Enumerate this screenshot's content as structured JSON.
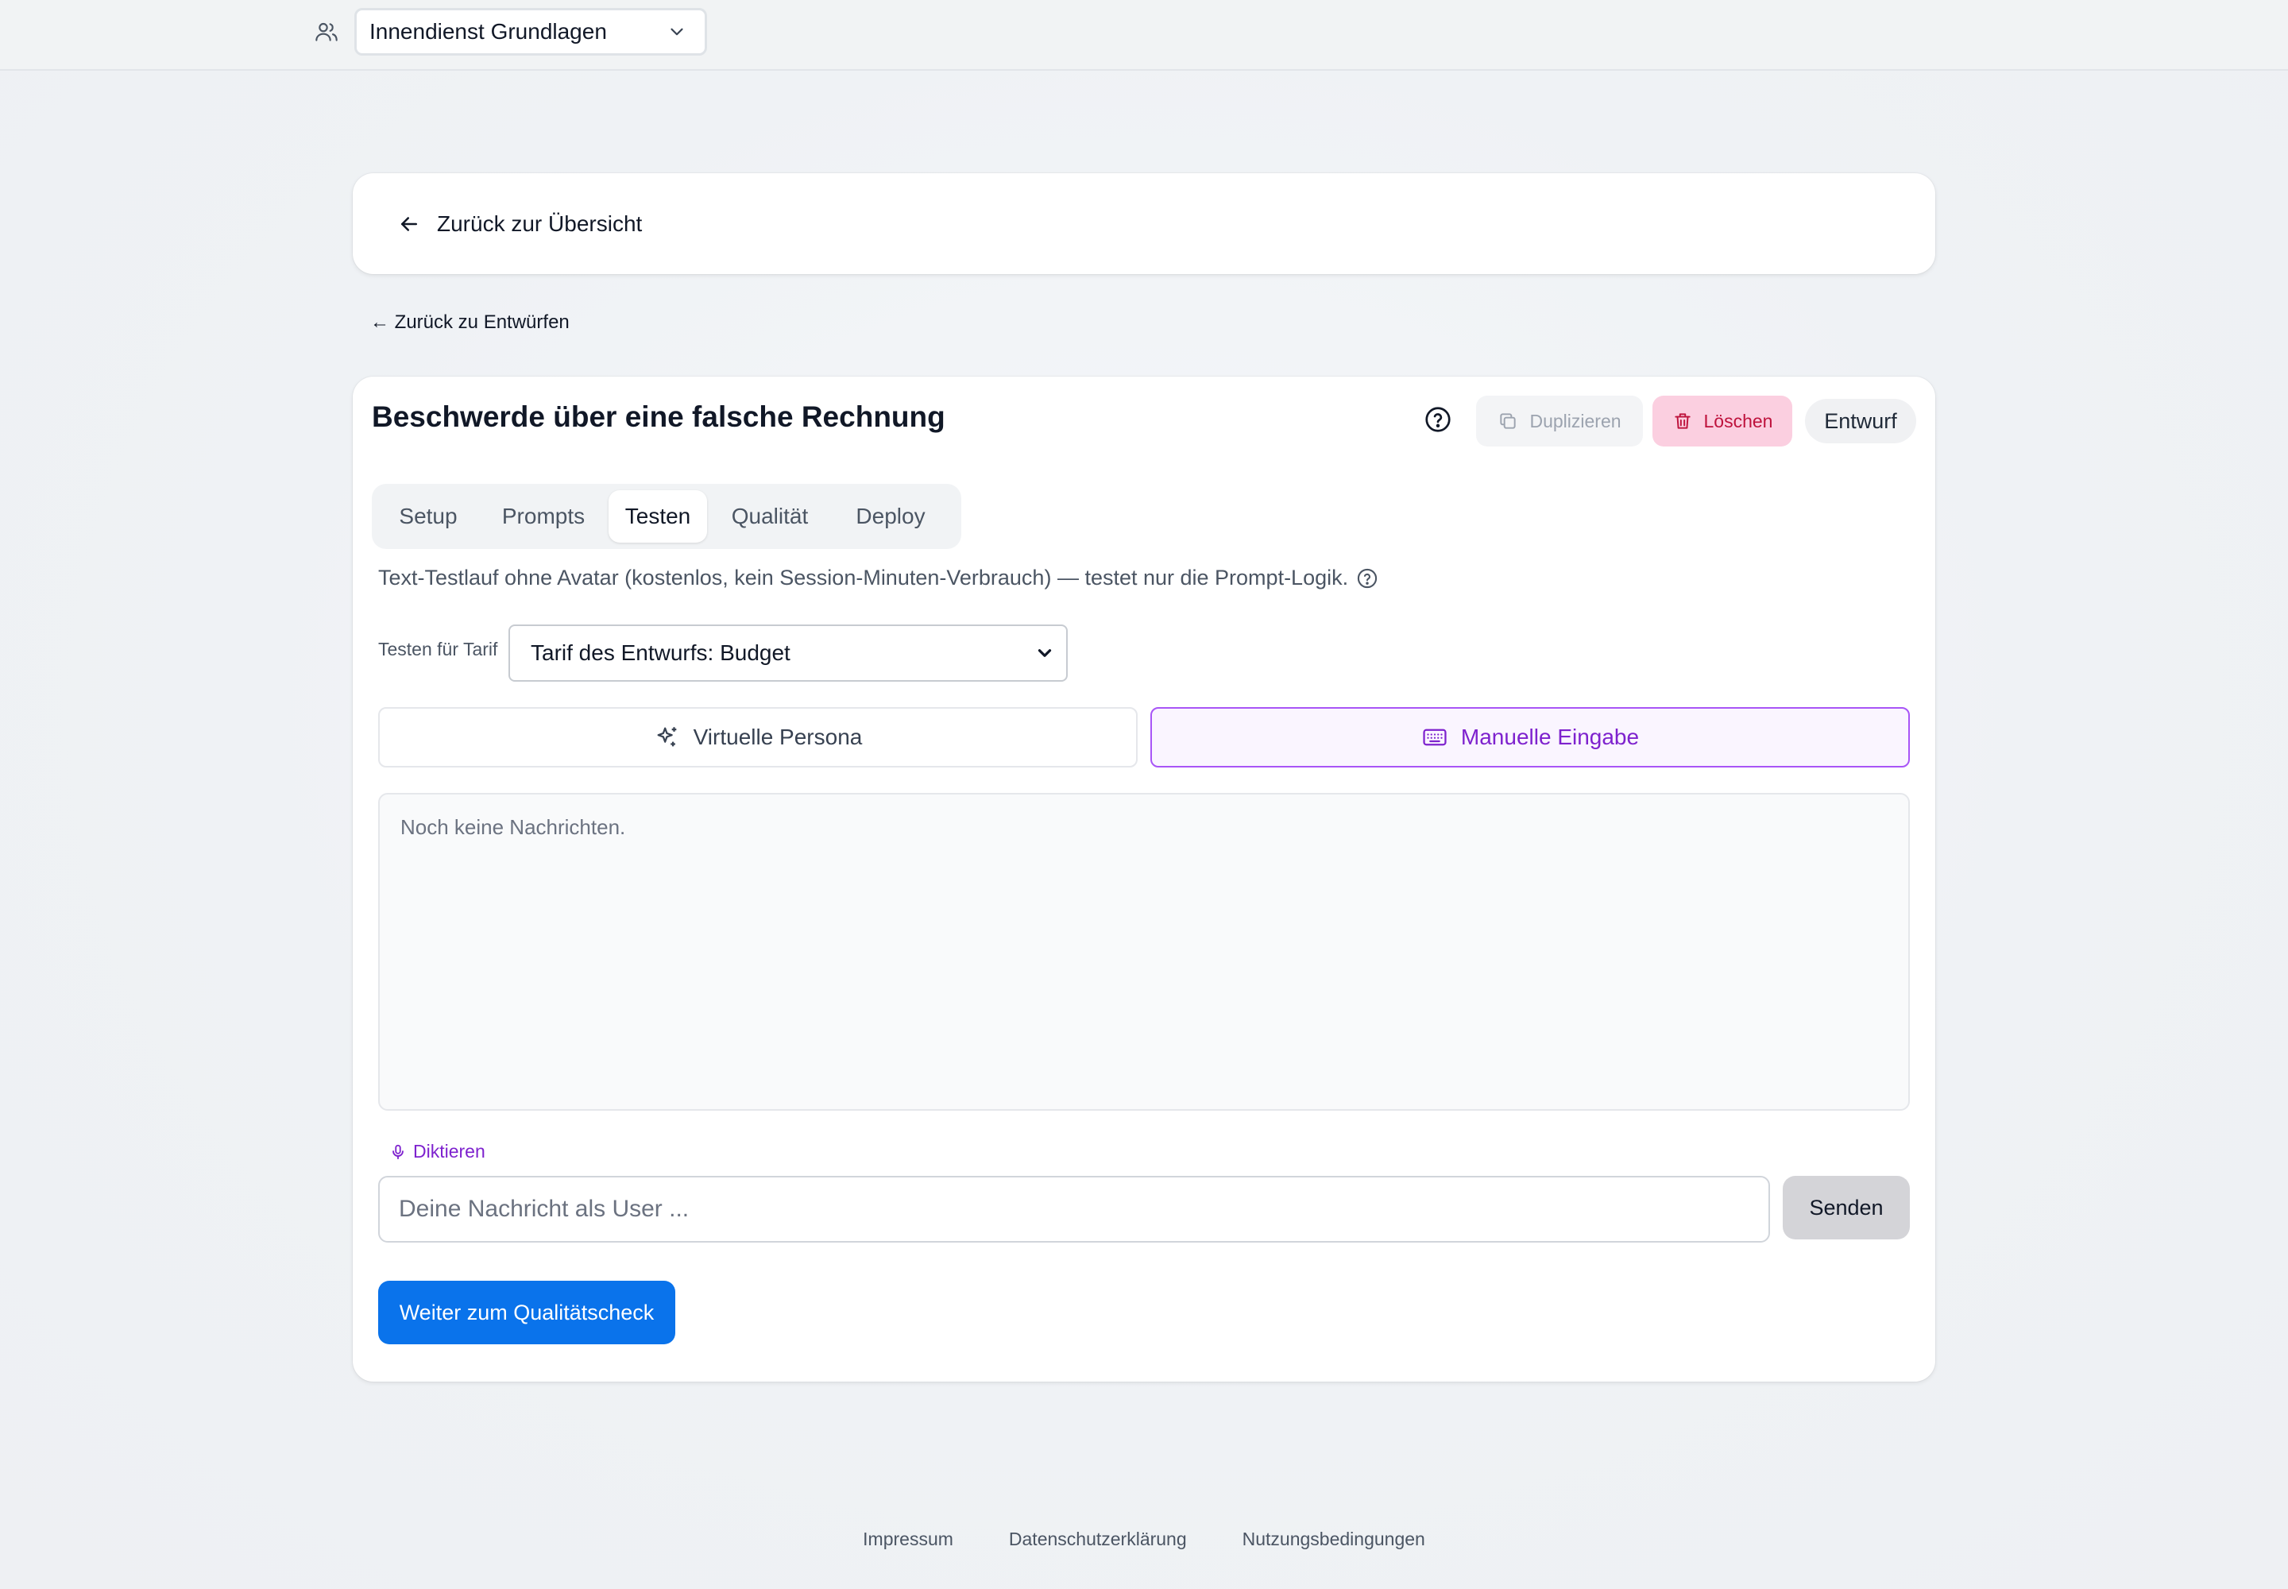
{
  "header": {
    "team_select_value": "Innendienst Grundlagen",
    "team_icon": "users-icon",
    "chevron_icon": "chevron-down-icon"
  },
  "nav": {
    "back_to_overview": "Zurück zur Übersicht",
    "back_to_drafts": "← Zurück zu Entwürfen"
  },
  "scenario": {
    "title": "Beschwerde über eine falsche Rechnung",
    "duplicate_label": "Duplizieren",
    "delete_label": "Löschen",
    "status_badge": "Entwurf"
  },
  "tabs": [
    {
      "label": "Setup",
      "active": false
    },
    {
      "label": "Prompts",
      "active": false
    },
    {
      "label": "Testen",
      "active": true
    },
    {
      "label": "Qualität",
      "active": false
    },
    {
      "label": "Deploy",
      "active": false
    }
  ],
  "test": {
    "info_text": "Text-Testlauf ohne Avatar (kostenlos, kein Session-Minuten-Verbrauch) — testet nur die Prompt-Logik.",
    "tarif_label": "Testen für Tarif",
    "tarif_value": "Tarif des Entwurfs: Budget",
    "mode_virtual": "Virtuelle Persona",
    "mode_manual": "Manuelle Eingabe",
    "selected_mode": "Manuelle Eingabe",
    "empty_messages": "Noch keine Nachrichten.",
    "dictate_label": "Diktieren",
    "message_placeholder": "Deine Nachricht als User ...",
    "message_value": "",
    "send_label": "Senden",
    "next_label": "Weiter zum Qualitätscheck"
  },
  "footer": {
    "links": [
      "Impressum",
      "Datenschutzerklärung",
      "Nutzungsbedingungen"
    ]
  },
  "colors": {
    "primary_blue": "#0a73eb",
    "accent_purple": "#7e22ce",
    "delete_bg": "#fbcfe0",
    "delete_text": "#be123c"
  }
}
